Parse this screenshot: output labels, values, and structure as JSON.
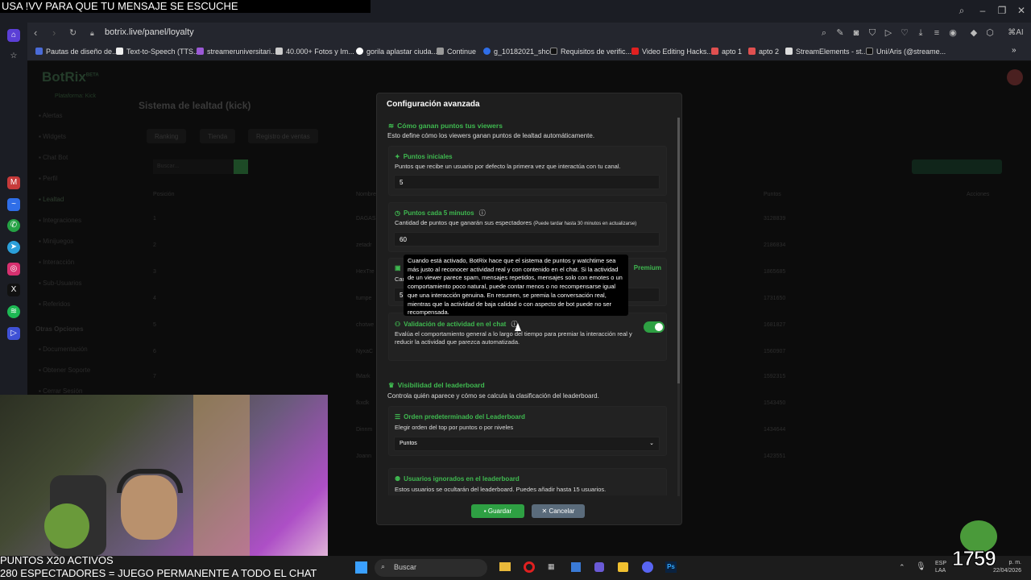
{
  "overlay": {
    "top_line": "USA !VV PARA QUE TU MENSAJE SE ESCUCHE",
    "bottom_line1": "PUNTOS X20 ACTIVOS",
    "bottom_line2": "280 ESPECTADORES = JUEGO PERMANENTE A TODO EL CHAT",
    "counter": "1759"
  },
  "browser": {
    "url": "botrix.live/panel/loyalty",
    "ai_label": "AI",
    "bookmarks": [
      "Pautas de diseño de...",
      "Text-to-Speech (TTS...",
      "streameruniversitari...",
      "40.000+ Fotos y Im...",
      "gorila aplastar ciuda...",
      "Continue",
      "g_10182021_shcc",
      "Requisitos de verific...",
      "Video Editing Hacks...",
      "apto 1",
      "apto 2",
      "StreamElements - st...",
      "Uni/Aris (@streame..."
    ]
  },
  "background_page": {
    "logo": "BotRix",
    "logo_badge": "BETA",
    "platform": "Plataforma: Kick",
    "title": "Sistema de lealtad (kick)",
    "nav": [
      "Alertas",
      "Widgets",
      "Chat Bot",
      "Perfil",
      "Lealtad",
      "Integraciones",
      "Minijuegos",
      "Interacción",
      "Sub-Usuarios",
      "Referidos",
      "Otras Opciones",
      "Documentación",
      "Obtener Soporte",
      "Cerrar Sesión"
    ],
    "tabs": [
      "Ranking",
      "Tienda",
      "Registro de ventas"
    ],
    "search_placeholder": "Buscar...",
    "columns": [
      "Posición",
      "Nombre",
      "Puntos",
      "Acciones"
    ],
    "rows": [
      {
        "pos": "1",
        "name": "DAGAS",
        "points": "3128839"
      },
      {
        "pos": "2",
        "name": "zetadr",
        "points": "2186834"
      },
      {
        "pos": "3",
        "name": "HexTre",
        "points": "1865685"
      },
      {
        "pos": "4",
        "name": "tumpe",
        "points": "1731650"
      },
      {
        "pos": "5",
        "name": "chotwe",
        "points": "1681827"
      },
      {
        "pos": "6",
        "name": "NyxaC",
        "points": "1560907"
      },
      {
        "pos": "7",
        "name": "fMark",
        "points": "1592315"
      },
      {
        "pos": "8",
        "name": "fkxdk",
        "points": "1543450"
      },
      {
        "pos": "9",
        "name": "Dinnm",
        "points": "1434644"
      },
      {
        "pos": "10",
        "name": "Joann",
        "points": "1423551"
      }
    ]
  },
  "modal": {
    "title": "Configuración avanzada",
    "section1": {
      "title": "Cómo ganan puntos tus viewers",
      "desc": "Esto define cómo los viewers ganan puntos de lealtad automáticamente."
    },
    "initial_points": {
      "title": "Puntos iniciales",
      "desc": "Puntos que recibe un usuario por defecto la primera vez que interactúa con tu canal.",
      "value": "5"
    },
    "points_5min": {
      "title": "Puntos cada 5 minutos",
      "desc": "Cantidad de puntos que ganarán sus espectadores",
      "desc_small": "(Puede tardar hasta 30 minutos en actualizarse)",
      "value": "60"
    },
    "hidden_card": {
      "premium": "Premium",
      "desc_prefix": "Can",
      "value": "5"
    },
    "tooltip": "Cuando está activado, BotRix hace que el sistema de puntos y watchtime sea más justo al reconocer actividad real y con contenido en el chat. Si la actividad de un viewer parece spam, mensajes repetidos, mensajes solo con emotes o un comportamiento poco natural, puede contar menos o no recompensarse igual que una interacción genuina. En resumen, se premia la conversación real, mientras que la actividad de baja calidad o con aspecto de bot puede no ser recompensada.",
    "activity_validation": {
      "title": "Validación de actividad en el chat",
      "desc": "Evalúa el comportamiento general a lo largo del tiempo para premiar la interacción real y reducir la actividad que parezca automatizada.",
      "enabled": true
    },
    "section2": {
      "title": "Visibilidad del leaderboard",
      "desc": "Controla quién aparece y cómo se calcula la clasificación del leaderboard."
    },
    "default_order": {
      "title": "Orden predeterminado del Leaderboard",
      "desc": "Elegir orden del top por puntos o por niveles",
      "selected": "Puntos"
    },
    "ignored_users": {
      "title": "Usuarios ignorados en el leaderboard",
      "desc": "Estos usuarios se ocultarán del leaderboard. Puedes añadir hasta 15 usuarios."
    },
    "save_label": "Guardar",
    "cancel_label": "Cancelar"
  },
  "taskbar": {
    "search": "Buscar",
    "lang": "ESP",
    "lang2": "LAA",
    "time": "p. m.",
    "date": "22/04/2026"
  },
  "colors": {
    "accent": "#3fb950",
    "cancel": "#5a6b7b"
  }
}
